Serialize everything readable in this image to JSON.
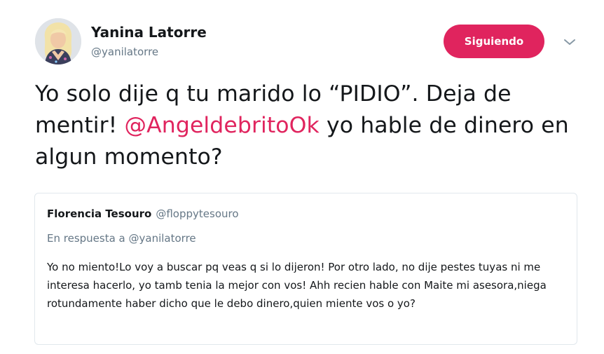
{
  "author": {
    "display_name": "Yanina Latorre",
    "handle": "@yanilatorre",
    "avatar_icon": "profile-photo"
  },
  "follow_button": {
    "label": "Siguiendo",
    "color": "#e0245e"
  },
  "menu": {
    "icon": "chevron-down-icon"
  },
  "tweet": {
    "text_part1": "Yo solo dije q tu marido lo “PIDIO”. Deja de mentir! ",
    "mention": "@AngeldebritoOk",
    "text_part2": " yo hable de dinero en algun momento?",
    "mention_color": "#e0245e"
  },
  "quoted_tweet": {
    "display_name": "Florencia Tesouro",
    "handle": "@floppytesouro",
    "reply_context": "En respuesta a @yanilatorre",
    "text": "Yo no miento!Lo voy a buscar pq veas q si lo dijeron! Por otro lado, no dije pestes tuyas ni me interesa hacerlo, yo tamb tenia la mejor con vos! Ahh recien hable con Maite mi asesora,niega rotundamente haber dicho que le debo dinero,quien miente vos o yo?"
  }
}
